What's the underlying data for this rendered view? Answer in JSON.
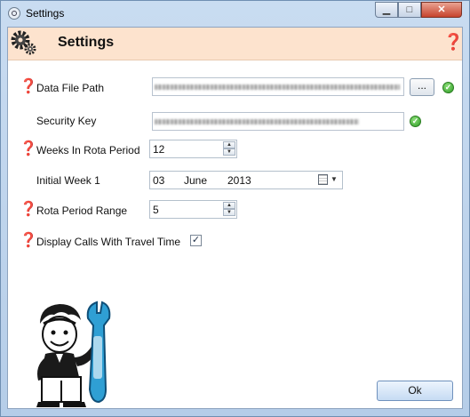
{
  "window": {
    "title": "Settings",
    "minimize_glyph": "▁",
    "maximize_glyph": "□",
    "close_glyph": "✕"
  },
  "header": {
    "title": "Settings",
    "help_glyph": "❓"
  },
  "fields": {
    "data_file_path": {
      "label": "Data File Path",
      "browse_label": "...",
      "help": "❓"
    },
    "security_key": {
      "label": "Security Key"
    },
    "weeks_in_rota": {
      "label": "Weeks In Rota Period",
      "value": "12",
      "help": "❓"
    },
    "initial_week": {
      "label": "Initial Week 1",
      "day": "03",
      "month": "June",
      "year": "2013"
    },
    "rota_period_range": {
      "label": "Rota Period Range",
      "value": "5",
      "help": "❓"
    },
    "display_calls": {
      "label": "Display Calls With Travel Time",
      "checked": true,
      "help": "❓"
    }
  },
  "buttons": {
    "ok": "Ok"
  },
  "icons": {
    "header": "gear-icon",
    "valid": "check-circle-icon",
    "calendar": "calendar-icon"
  },
  "colors": {
    "header_bg": "#fde3ce",
    "help": "#d01818",
    "valid": "#2c9a24"
  }
}
